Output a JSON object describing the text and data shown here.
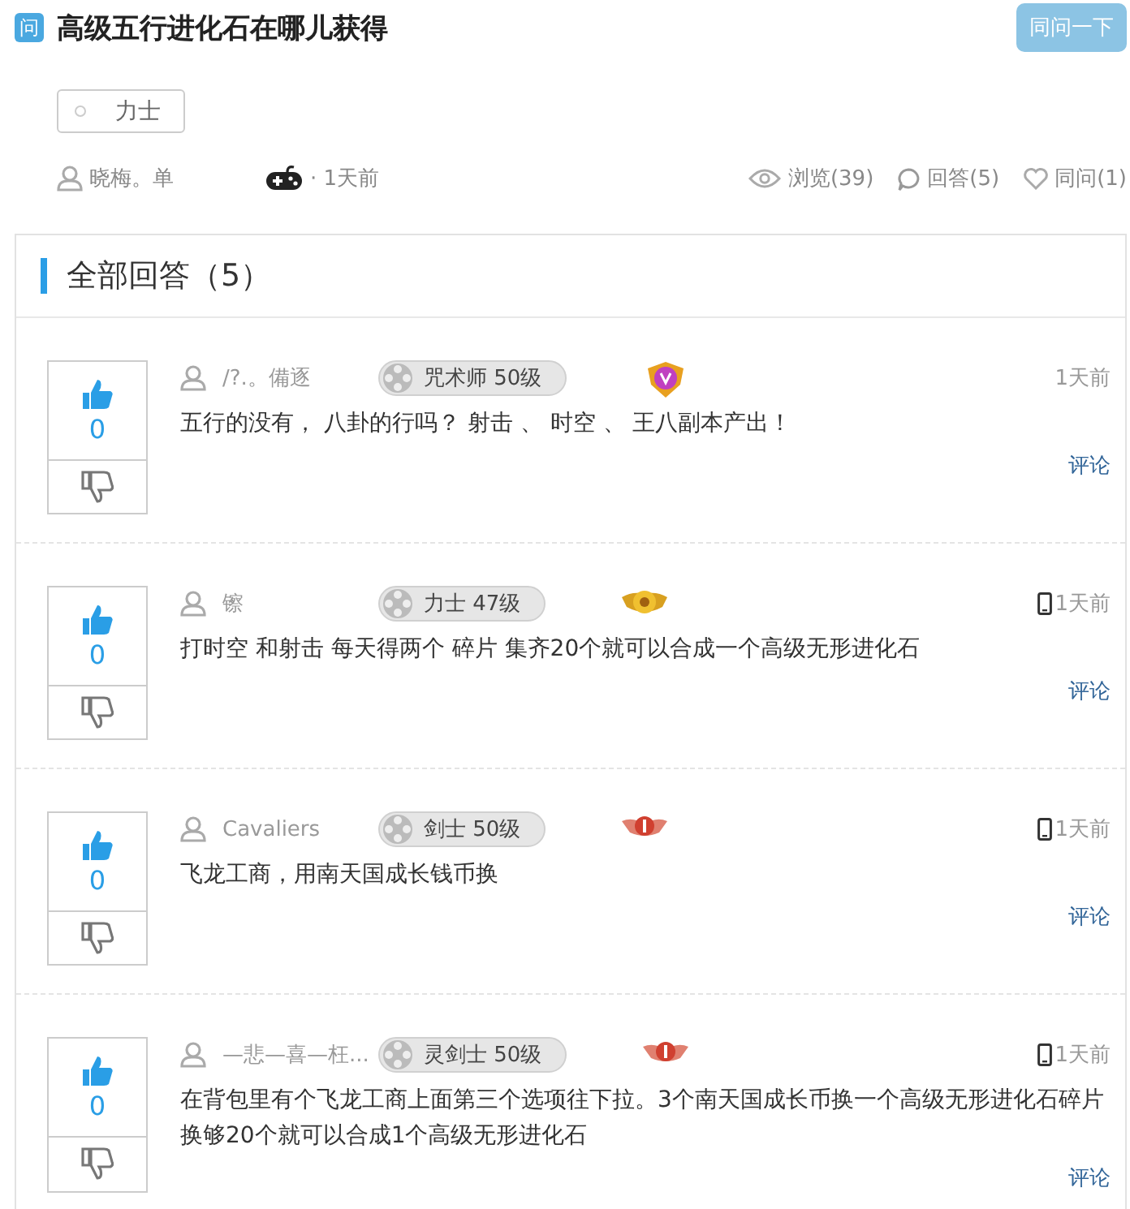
{
  "question": {
    "badge": "问",
    "title": "高级五行进化石在哪儿获得",
    "ask_button": "同问一下",
    "tag": "力士",
    "author": "晓梅。单",
    "time": "· 1天前",
    "views": "浏览(39)",
    "answers": "回答(5)",
    "same": "同问(1)"
  },
  "answers_panel": {
    "heading": "全部回答（5）"
  },
  "answers": [
    {
      "user": "/?.。備逐",
      "role": "咒术师 50级",
      "kind": "gem",
      "mobile": false,
      "time": "1天前",
      "content": "五行的没有， 八卦的行吗？  射击 、 时空 、 王八副本产出！",
      "comment": "评论",
      "votes": "0"
    },
    {
      "user": "镲",
      "role": "力士 47级",
      "kind": "gold",
      "mobile": true,
      "time": "1天前",
      "content": "打时空 和射击 每天得两个 碎片 集齐20个就可以合成一个高级无形进化石",
      "comment": "评论",
      "votes": "0"
    },
    {
      "user": "Cavaliers",
      "role": "剑士 50级",
      "kind": "wings",
      "mobile": true,
      "time": "1天前",
      "content": "飞龙工商，用南天国成长钱币换",
      "comment": "评论",
      "votes": "0"
    },
    {
      "user": "—悲—喜—枉...",
      "role": "灵剑士 50级",
      "kind": "wings",
      "mobile": true,
      "time": "1天前",
      "content": "在背包里有个飞龙工商上面第三个选项往下拉。3个南天国成长币换一个高级无形进化石碎片换够20个就可以合成1个高级无形进化石",
      "comment": "评论",
      "votes": "0"
    }
  ]
}
